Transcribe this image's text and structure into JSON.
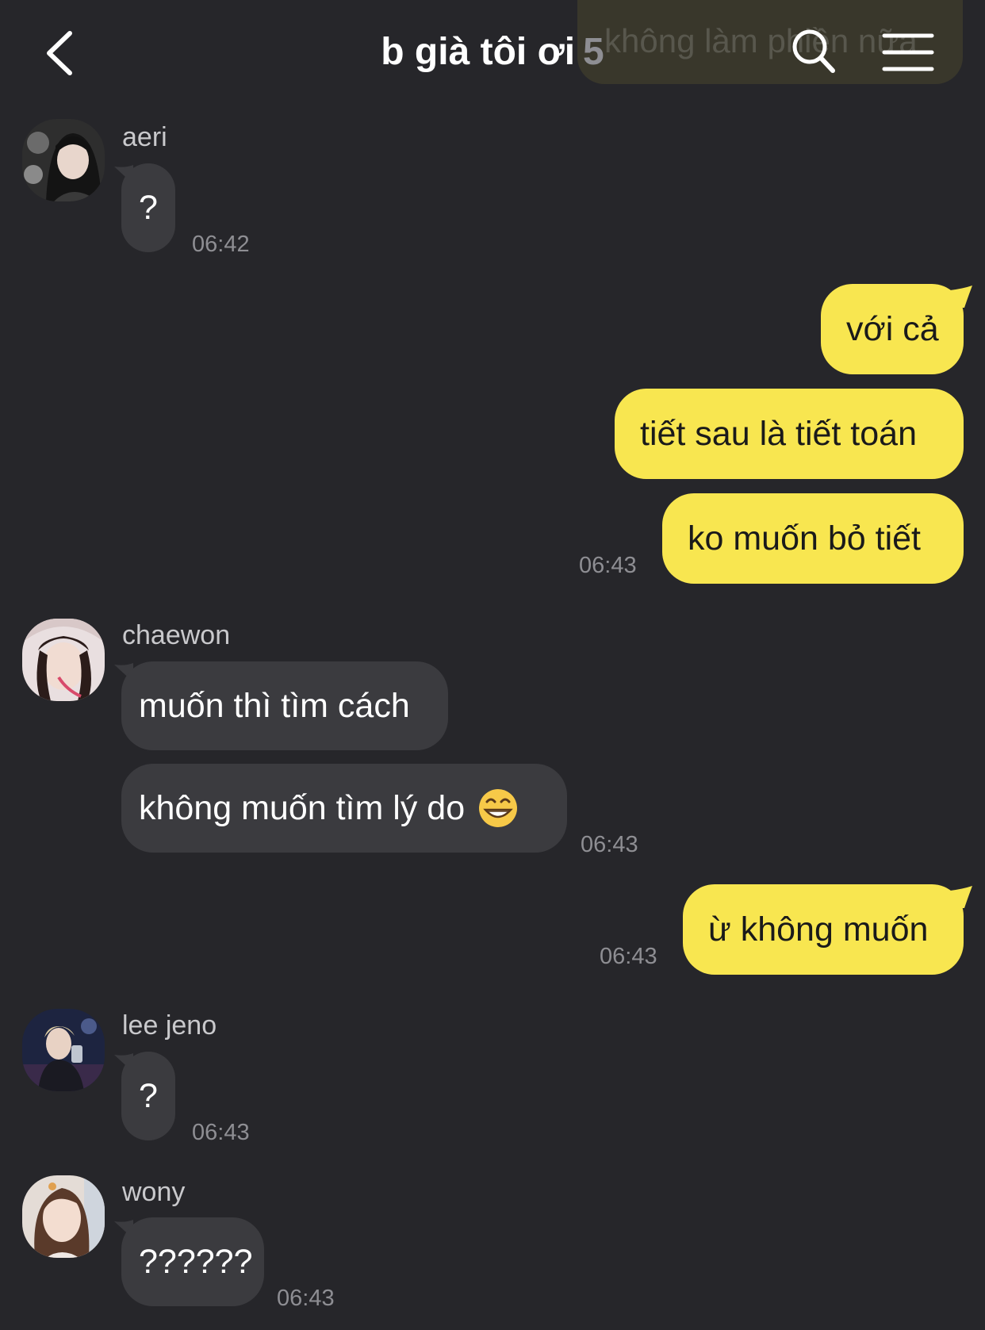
{
  "header": {
    "title": "b già tôi ơi",
    "member_count": "5",
    "preview_text": "không làm phiền nữa"
  },
  "messages": [
    {
      "sender": "aeri",
      "text": "?",
      "time": "06:42"
    },
    {
      "sender": "me",
      "text": "với cả"
    },
    {
      "sender": "me",
      "text": "tiết sau là tiết toán"
    },
    {
      "sender": "me",
      "text": "ko muốn bỏ tiết",
      "time": "06:43"
    },
    {
      "sender": "chaewon",
      "text": "muốn thì tìm cách"
    },
    {
      "sender": "chaewon",
      "text": "không muốn tìm lý do",
      "emoji": "grinning-face",
      "time": "06:43"
    },
    {
      "sender": "me",
      "text": "ừ không muốn",
      "time": "06:43"
    },
    {
      "sender": "lee jeno",
      "text": "?",
      "time": "06:43"
    },
    {
      "sender": "wony",
      "text": "??????",
      "time": "06:43"
    }
  ],
  "colors": {
    "background": "#26262a",
    "incoming_bubble": "#3b3b3f",
    "outgoing_bubble": "#f8e650",
    "timestamp": "#8e8e93"
  }
}
